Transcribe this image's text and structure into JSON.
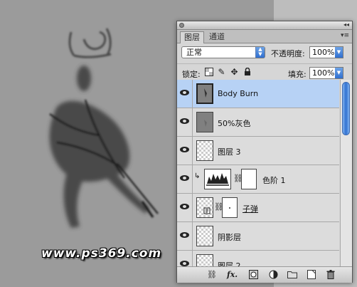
{
  "watermark": "www.ps369.com",
  "panel": {
    "tabs": [
      {
        "label": "图层",
        "active": true
      },
      {
        "label": "通道",
        "active": false
      }
    ],
    "blend_mode": "正常",
    "opacity_label": "不透明度:",
    "opacity_value": "100%",
    "lock_label": "锁定:",
    "fill_label": "填充:",
    "fill_value": "100%",
    "lock_icons": [
      "lock-transparent-icon",
      "lock-brush-icon",
      "lock-move-icon",
      "lock-all-icon"
    ],
    "layers": [
      {
        "name": "Body Burn",
        "selected": true,
        "thumb": "grey-with-figure"
      },
      {
        "name": "50%灰色",
        "selected": false,
        "thumb": "grey"
      },
      {
        "name": "图层 3",
        "selected": false,
        "thumb": "transparent"
      },
      {
        "name": "色阶 1",
        "selected": false,
        "thumb": "levels-adjustment"
      },
      {
        "name": "子弹",
        "selected": false,
        "thumb": "smart-object"
      },
      {
        "name": "阴影层",
        "selected": false,
        "thumb": "transparent"
      },
      {
        "name": "图层 2",
        "selected": false,
        "thumb": "transparent"
      }
    ],
    "bottom_icons": [
      "link-layers-icon",
      "fx-icon",
      "add-mask-icon",
      "adjustment-layer-icon",
      "new-group-icon",
      "new-layer-icon",
      "delete-icon"
    ],
    "bottom_fx_label": "fx."
  },
  "colors": {
    "selection": "#b7d2f5",
    "accent": "#2f71d1"
  }
}
